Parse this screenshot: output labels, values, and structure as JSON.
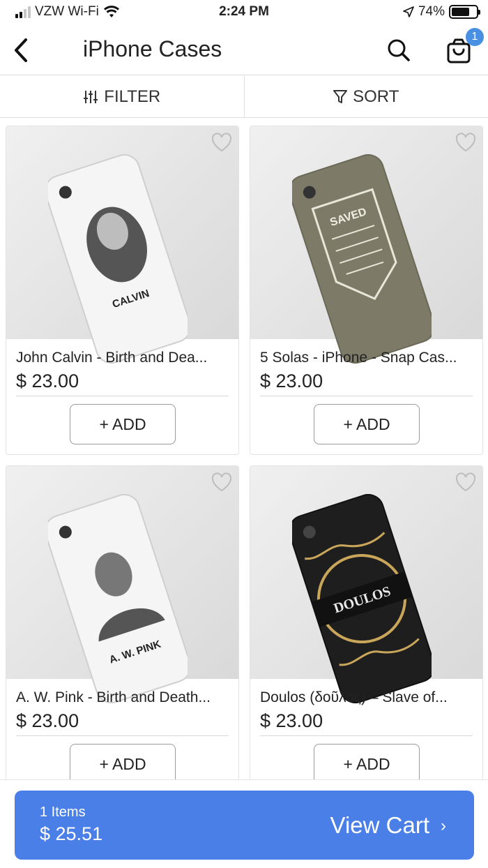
{
  "status_bar": {
    "carrier": "VZW Wi-Fi",
    "time": "2:24 PM",
    "battery_percent": "74%",
    "battery_level": 0.74
  },
  "nav": {
    "title": "iPhone Cases",
    "cart_badge": "1",
    "icons": [
      "back-chevron-icon",
      "search-icon",
      "shopping-bag-icon"
    ]
  },
  "toolbar": {
    "filter_label": "FILTER",
    "sort_label": "SORT",
    "icons": [
      "sliders-icon",
      "funnel-icon"
    ]
  },
  "products": [
    {
      "name": "John Calvin - Birth and Dea...",
      "price": "$ 23.00",
      "add_label": "+ ADD",
      "case_text": "CALVIN",
      "case_color": "#f4f4f4"
    },
    {
      "name": "5 Solas - iPhone - Snap Cas...",
      "price": "$ 23.00",
      "add_label": "+ ADD",
      "case_text": "SAVED",
      "case_color": "#7d7b68"
    },
    {
      "name": "A. W. Pink - Birth and Death...",
      "price": "$ 23.00",
      "add_label": "+ ADD",
      "case_text": "A. W. PINK",
      "case_color": "#f4f4f4"
    },
    {
      "name": "Doulos (δοῦλος) – Slave of...",
      "price": "$ 23.00",
      "add_label": "+ ADD",
      "case_text": "DOULOS",
      "case_color": "#1e1e1e"
    }
  ],
  "cart_bar": {
    "items": "1 Items",
    "total": "$ 25.51",
    "view_label": "View Cart",
    "chevron": "›",
    "color": "#4a7fe8"
  }
}
